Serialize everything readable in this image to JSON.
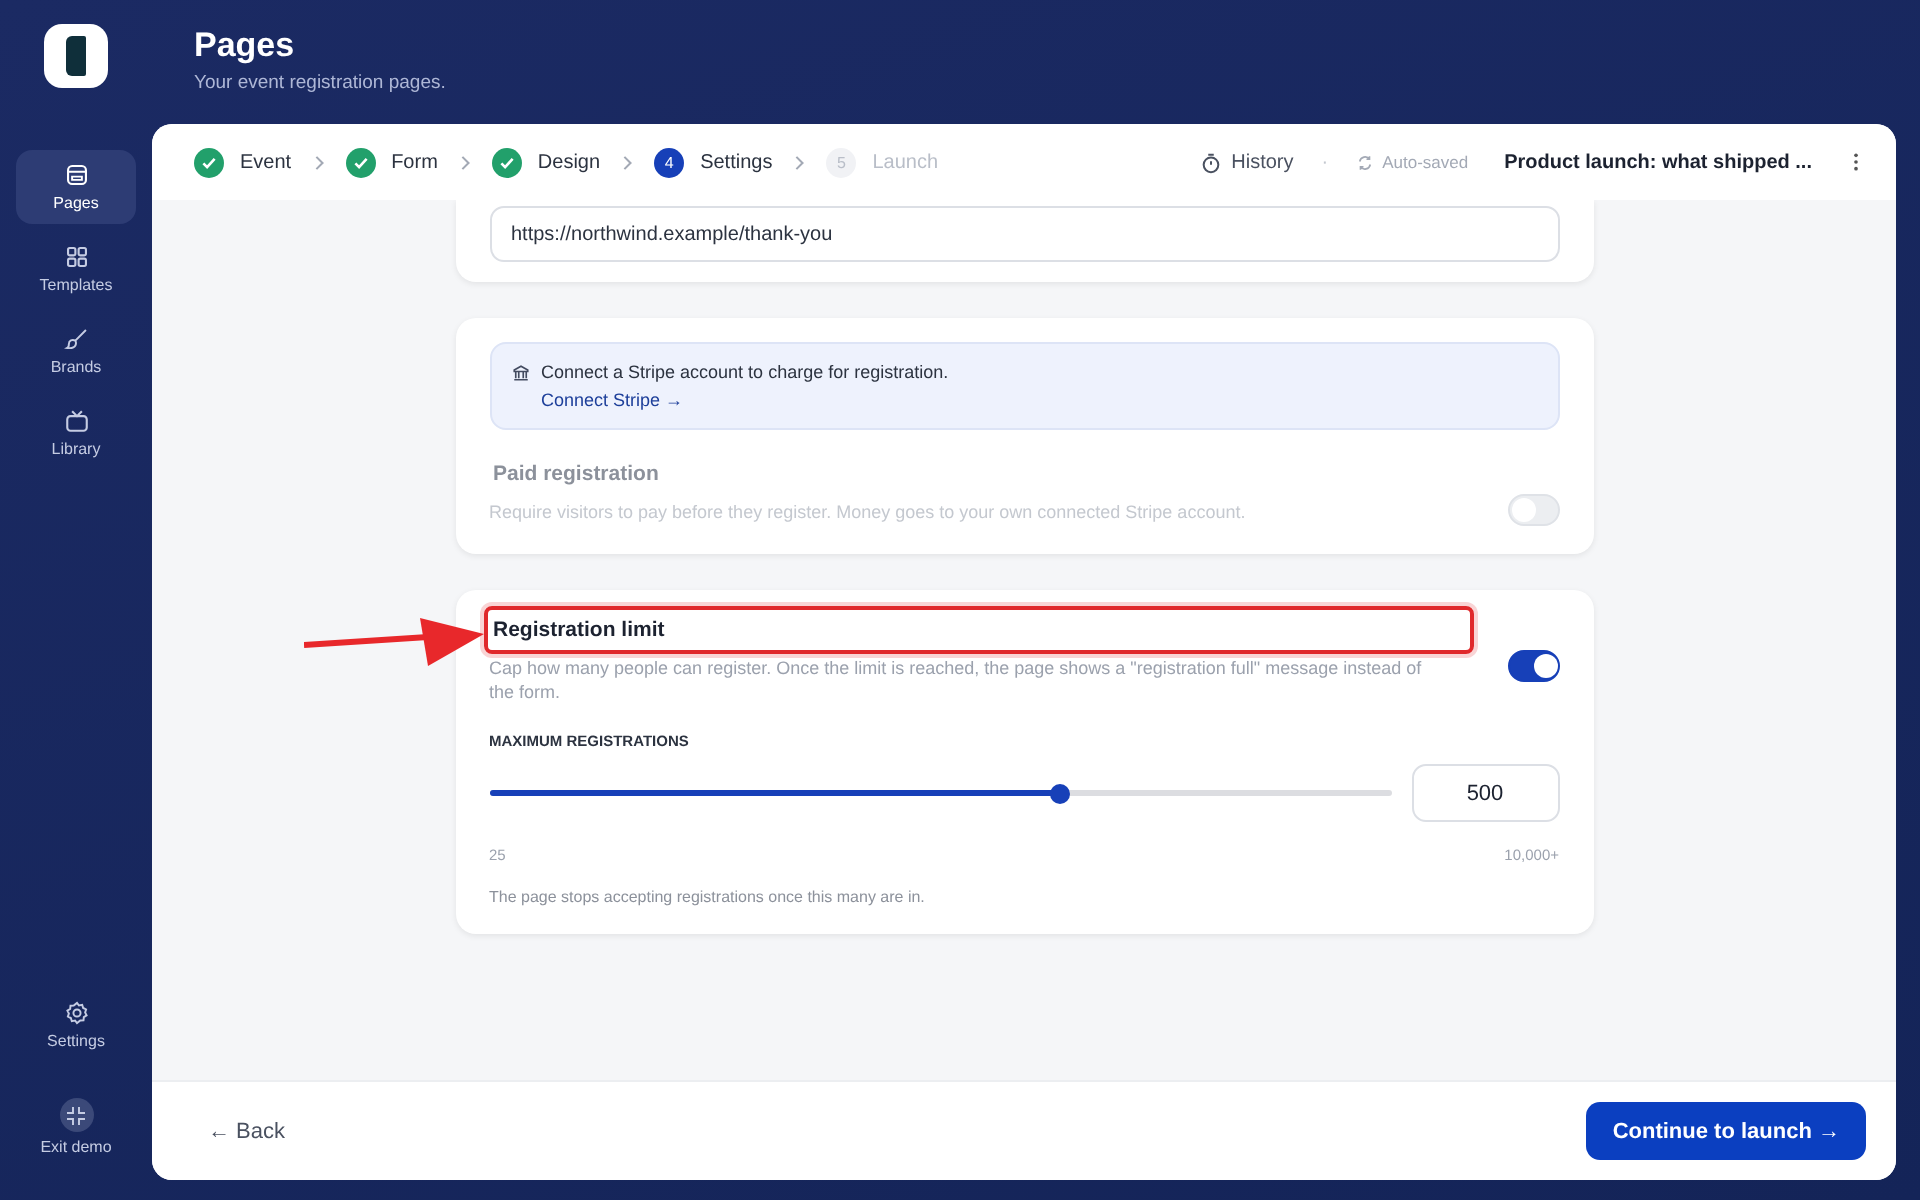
{
  "sidebar": {
    "items": [
      {
        "label": "Pages",
        "selected": true
      },
      {
        "label": "Templates",
        "selected": false
      },
      {
        "label": "Brands",
        "selected": false
      },
      {
        "label": "Library",
        "selected": false
      }
    ],
    "bottom": [
      {
        "label": "Settings"
      },
      {
        "label": "Exit demo"
      }
    ]
  },
  "header": {
    "title": "Pages",
    "subtitle": "Your event registration pages."
  },
  "steps": [
    {
      "label": "Event",
      "kind": "done"
    },
    {
      "label": "Form",
      "kind": "done"
    },
    {
      "label": "Design",
      "kind": "done"
    },
    {
      "number": "4",
      "label": "Settings",
      "kind": "current"
    },
    {
      "number": "5",
      "label": "Launch",
      "kind": "upcoming"
    }
  ],
  "toolbar": {
    "history": "History",
    "separator": "·",
    "autosave": "Auto-saved",
    "page_title": "Product launch: what shipped ..."
  },
  "redirect_field": {
    "value": "https://northwind.example/thank-you"
  },
  "stripe_notice": {
    "text": "Connect a Stripe account to charge for registration.",
    "link": "Connect Stripe →"
  },
  "settings": [
    {
      "title": "Paid registration",
      "description": "Require visitors to pay before they register. Money goes to your own connected Stripe account.",
      "on": false,
      "disabled": true,
      "highlighted": false
    },
    {
      "title": "Registration limit",
      "description": "Cap how many people can register. Once the limit is reached, the page shows a \"registration full\" message instead of the form.",
      "on": true,
      "disabled": false,
      "highlighted": true
    }
  ],
  "limit": {
    "label": "MAXIMUM REGISTRATIONS",
    "level": 0.633,
    "value": "500",
    "min": "25",
    "max": "10,000+",
    "hint": "The page stops accepting registrations once this many are in."
  },
  "footer": {
    "back": "← Back",
    "continue": "Continue to launch →"
  }
}
